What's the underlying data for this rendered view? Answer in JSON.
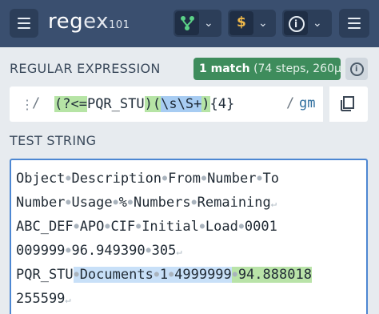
{
  "header": {
    "logo_main": "reg",
    "logo_ex": "ex",
    "logo_version": "101",
    "flavor_icon": "branch-icon",
    "function_icon": "dollar-icon",
    "function_symbol": "$",
    "info_icon": "info-icon",
    "info_symbol": "i"
  },
  "regex_section": {
    "title": "REGULAR EXPRESSION",
    "match_count": "1 match",
    "match_info": "(74 steps, 260µs)",
    "open_delim": "/",
    "parts": [
      "(?<=",
      "PQR_STU",
      ")",
      "(",
      "\\s\\S+",
      ")",
      "{4}"
    ],
    "close_delim": "/",
    "flags": "gm"
  },
  "test_section": {
    "title": "TEST STRING",
    "lines": [
      [
        "Object",
        "Description",
        "From",
        "Number",
        "To"
      ],
      [
        "Number",
        "Usage",
        "%",
        "Numbers",
        "Remaining"
      ],
      [
        "ABC_DEF",
        "APO",
        "CIF",
        "Initial",
        "Load",
        "0001"
      ],
      [
        "009999",
        "96.949390",
        "305"
      ],
      [
        "PQR_STU"
      ],
      [
        "255599"
      ]
    ],
    "match_line": {
      "prefix": "PQR_STU",
      "blue_parts": [
        "Documents",
        "1",
        "4999999"
      ],
      "green_part": "94.888018"
    }
  },
  "colors": {
    "topbar": "#3a4f6f",
    "match_badge": "#3e8c5c",
    "regex_group_green": "#b6e4a5",
    "regex_class_blue": "#a7ccf2",
    "test_border": "#4d87d2"
  }
}
